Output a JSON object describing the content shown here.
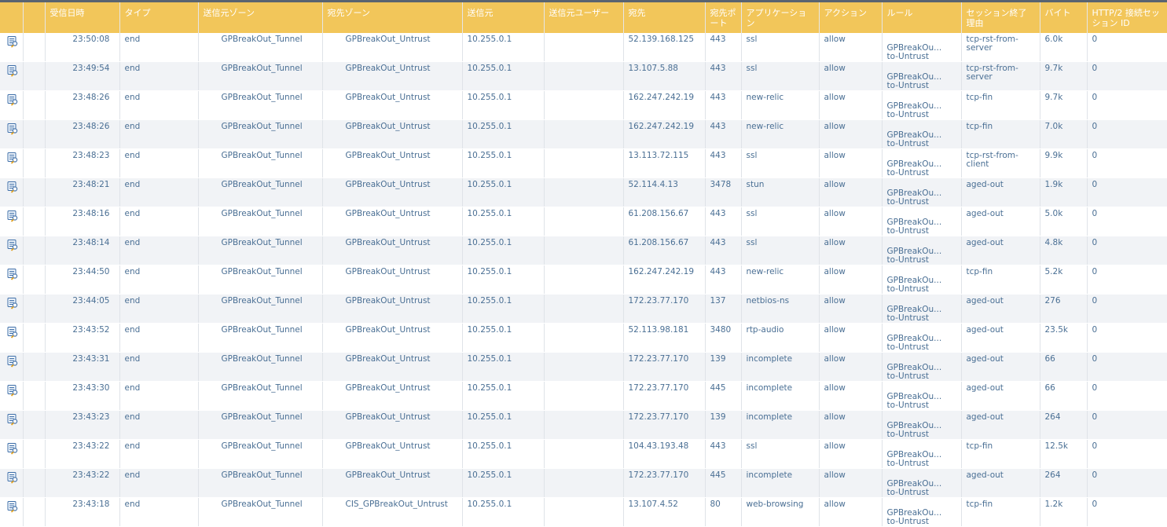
{
  "columns": {
    "icon": "",
    "blank": "",
    "time": "受信日時",
    "type": "タイプ",
    "src_zone": "送信元ゾーン",
    "dst_zone": "宛先ゾーン",
    "source": "送信元",
    "src_user": "送信元ユーザー",
    "destination": "宛先",
    "dst_port": "宛先ポート",
    "application": "アプリケーション",
    "action": "アクション",
    "rule": "ルール",
    "end_reason": "セッション終了理由",
    "bytes": "バイト",
    "http2": "HTTP/2 接続セッション ID"
  },
  "icons": {
    "row_icon": "log-detail-icon"
  },
  "colors": {
    "header_bg": "#f2c65a",
    "header_text": "#ffffff",
    "cell_text": "#4a6f94",
    "row_alt": "#f1f3f6"
  },
  "rows": [
    {
      "time": "23:50:08",
      "type": "end",
      "src_zone": "GPBreakOut_Tunnel",
      "dst_zone": "GPBreakOut_Untrust",
      "source": "10.255.0.1",
      "src_user": "",
      "destination": "52.139.168.125",
      "dst_port": "443",
      "application": "ssl",
      "action": "allow",
      "rule_line1": "GPBreakOu...",
      "rule_line2": "to-Untrust",
      "end_reason": "tcp-rst-from-server",
      "bytes": "6.0k",
      "http2": "0"
    },
    {
      "time": "23:49:54",
      "type": "end",
      "src_zone": "GPBreakOut_Tunnel",
      "dst_zone": "GPBreakOut_Untrust",
      "source": "10.255.0.1",
      "src_user": "",
      "destination": "13.107.5.88",
      "dst_port": "443",
      "application": "ssl",
      "action": "allow",
      "rule_line1": "GPBreakOu...",
      "rule_line2": "to-Untrust",
      "end_reason": "tcp-rst-from-server",
      "bytes": "9.7k",
      "http2": "0"
    },
    {
      "time": "23:48:26",
      "type": "end",
      "src_zone": "GPBreakOut_Tunnel",
      "dst_zone": "GPBreakOut_Untrust",
      "source": "10.255.0.1",
      "src_user": "",
      "destination": "162.247.242.19",
      "dst_port": "443",
      "application": "new-relic",
      "action": "allow",
      "rule_line1": "GPBreakOu...",
      "rule_line2": "to-Untrust",
      "end_reason": "tcp-fin",
      "bytes": "9.7k",
      "http2": "0"
    },
    {
      "time": "23:48:26",
      "type": "end",
      "src_zone": "GPBreakOut_Tunnel",
      "dst_zone": "GPBreakOut_Untrust",
      "source": "10.255.0.1",
      "src_user": "",
      "destination": "162.247.242.19",
      "dst_port": "443",
      "application": "new-relic",
      "action": "allow",
      "rule_line1": "GPBreakOu...",
      "rule_line2": "to-Untrust",
      "end_reason": "tcp-fin",
      "bytes": "7.0k",
      "http2": "0"
    },
    {
      "time": "23:48:23",
      "type": "end",
      "src_zone": "GPBreakOut_Tunnel",
      "dst_zone": "GPBreakOut_Untrust",
      "source": "10.255.0.1",
      "src_user": "",
      "destination": "13.113.72.115",
      "dst_port": "443",
      "application": "ssl",
      "action": "allow",
      "rule_line1": "GPBreakOu...",
      "rule_line2": "to-Untrust",
      "end_reason": "tcp-rst-from-client",
      "bytes": "9.9k",
      "http2": "0"
    },
    {
      "time": "23:48:21",
      "type": "end",
      "src_zone": "GPBreakOut_Tunnel",
      "dst_zone": "GPBreakOut_Untrust",
      "source": "10.255.0.1",
      "src_user": "",
      "destination": "52.114.4.13",
      "dst_port": "3478",
      "application": "stun",
      "action": "allow",
      "rule_line1": "GPBreakOu...",
      "rule_line2": "to-Untrust",
      "end_reason": "aged-out",
      "bytes": "1.9k",
      "http2": "0"
    },
    {
      "time": "23:48:16",
      "type": "end",
      "src_zone": "GPBreakOut_Tunnel",
      "dst_zone": "GPBreakOut_Untrust",
      "source": "10.255.0.1",
      "src_user": "",
      "destination": "61.208.156.67",
      "dst_port": "443",
      "application": "ssl",
      "action": "allow",
      "rule_line1": "GPBreakOu...",
      "rule_line2": "to-Untrust",
      "end_reason": "aged-out",
      "bytes": "5.0k",
      "http2": "0"
    },
    {
      "time": "23:48:14",
      "type": "end",
      "src_zone": "GPBreakOut_Tunnel",
      "dst_zone": "GPBreakOut_Untrust",
      "source": "10.255.0.1",
      "src_user": "",
      "destination": "61.208.156.67",
      "dst_port": "443",
      "application": "ssl",
      "action": "allow",
      "rule_line1": "GPBreakOu...",
      "rule_line2": "to-Untrust",
      "end_reason": "aged-out",
      "bytes": "4.8k",
      "http2": "0"
    },
    {
      "time": "23:44:50",
      "type": "end",
      "src_zone": "GPBreakOut_Tunnel",
      "dst_zone": "GPBreakOut_Untrust",
      "source": "10.255.0.1",
      "src_user": "",
      "destination": "162.247.242.19",
      "dst_port": "443",
      "application": "new-relic",
      "action": "allow",
      "rule_line1": "GPBreakOu...",
      "rule_line2": "to-Untrust",
      "end_reason": "tcp-fin",
      "bytes": "5.2k",
      "http2": "0"
    },
    {
      "time": "23:44:05",
      "type": "end",
      "src_zone": "GPBreakOut_Tunnel",
      "dst_zone": "GPBreakOut_Untrust",
      "source": "10.255.0.1",
      "src_user": "",
      "destination": "172.23.77.170",
      "dst_port": "137",
      "application": "netbios-ns",
      "action": "allow",
      "rule_line1": "GPBreakOu...",
      "rule_line2": "to-Untrust",
      "end_reason": "aged-out",
      "bytes": "276",
      "http2": "0"
    },
    {
      "time": "23:43:52",
      "type": "end",
      "src_zone": "GPBreakOut_Tunnel",
      "dst_zone": "GPBreakOut_Untrust",
      "source": "10.255.0.1",
      "src_user": "",
      "destination": "52.113.98.181",
      "dst_port": "3480",
      "application": "rtp-audio",
      "action": "allow",
      "rule_line1": "GPBreakOu...",
      "rule_line2": "to-Untrust",
      "end_reason": "aged-out",
      "bytes": "23.5k",
      "http2": "0"
    },
    {
      "time": "23:43:31",
      "type": "end",
      "src_zone": "GPBreakOut_Tunnel",
      "dst_zone": "GPBreakOut_Untrust",
      "source": "10.255.0.1",
      "src_user": "",
      "destination": "172.23.77.170",
      "dst_port": "139",
      "application": "incomplete",
      "action": "allow",
      "rule_line1": "GPBreakOu...",
      "rule_line2": "to-Untrust",
      "end_reason": "aged-out",
      "bytes": "66",
      "http2": "0"
    },
    {
      "time": "23:43:30",
      "type": "end",
      "src_zone": "GPBreakOut_Tunnel",
      "dst_zone": "GPBreakOut_Untrust",
      "source": "10.255.0.1",
      "src_user": "",
      "destination": "172.23.77.170",
      "dst_port": "445",
      "application": "incomplete",
      "action": "allow",
      "rule_line1": "GPBreakOu...",
      "rule_line2": "to-Untrust",
      "end_reason": "aged-out",
      "bytes": "66",
      "http2": "0"
    },
    {
      "time": "23:43:23",
      "type": "end",
      "src_zone": "GPBreakOut_Tunnel",
      "dst_zone": "GPBreakOut_Untrust",
      "source": "10.255.0.1",
      "src_user": "",
      "destination": "172.23.77.170",
      "dst_port": "139",
      "application": "incomplete",
      "action": "allow",
      "rule_line1": "GPBreakOu...",
      "rule_line2": "to-Untrust",
      "end_reason": "aged-out",
      "bytes": "264",
      "http2": "0"
    },
    {
      "time": "23:43:22",
      "type": "end",
      "src_zone": "GPBreakOut_Tunnel",
      "dst_zone": "GPBreakOut_Untrust",
      "source": "10.255.0.1",
      "src_user": "",
      "destination": "104.43.193.48",
      "dst_port": "443",
      "application": "ssl",
      "action": "allow",
      "rule_line1": "GPBreakOu...",
      "rule_line2": "to-Untrust",
      "end_reason": "tcp-fin",
      "bytes": "12.5k",
      "http2": "0"
    },
    {
      "time": "23:43:22",
      "type": "end",
      "src_zone": "GPBreakOut_Tunnel",
      "dst_zone": "GPBreakOut_Untrust",
      "source": "10.255.0.1",
      "src_user": "",
      "destination": "172.23.77.170",
      "dst_port": "445",
      "application": "incomplete",
      "action": "allow",
      "rule_line1": "GPBreakOu...",
      "rule_line2": "to-Untrust",
      "end_reason": "aged-out",
      "bytes": "264",
      "http2": "0"
    },
    {
      "time": "23:43:18",
      "type": "end",
      "src_zone": "GPBreakOut_Tunnel",
      "dst_zone": "CIS_GPBreakOut_Untrust",
      "source": "10.255.0.1",
      "src_user": "",
      "destination": "13.107.4.52",
      "dst_port": "80",
      "application": "web-browsing",
      "action": "allow",
      "rule_line1": "GPBreakOu...",
      "rule_line2": "to-Untrust",
      "end_reason": "tcp-fin",
      "bytes": "1.2k",
      "http2": "0"
    }
  ]
}
